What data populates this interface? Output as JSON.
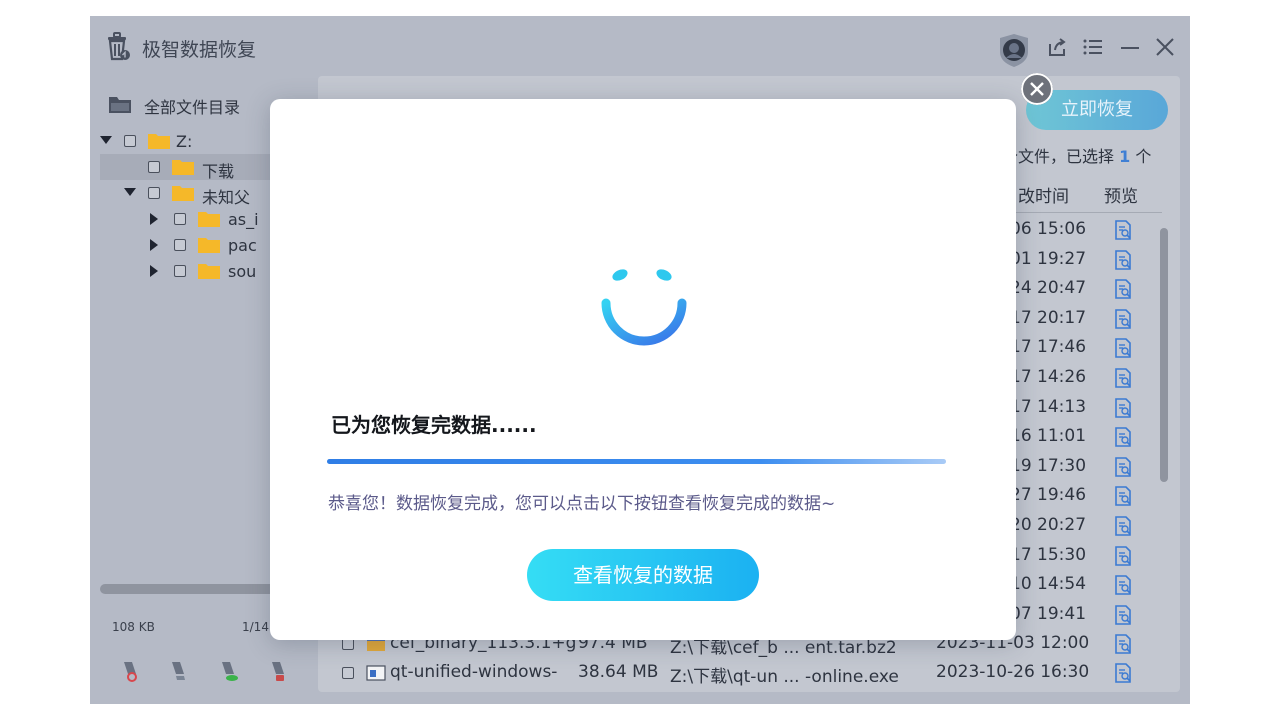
{
  "app": {
    "title": "极智数据恢复"
  },
  "left_panel": {
    "all_directories_label": "全部文件目录",
    "tree": [
      {
        "label": "Z:",
        "arrow": "down",
        "selected": false
      },
      {
        "label": "下载",
        "arrow": "none",
        "selected": true
      },
      {
        "label": "未知父",
        "arrow": "down",
        "selected": false
      },
      {
        "label": "as_i",
        "arrow": "right",
        "selected": false
      },
      {
        "label": "pac",
        "arrow": "right",
        "selected": false
      },
      {
        "label": "sou",
        "arrow": "right",
        "selected": false
      }
    ],
    "size_label": "108 KB",
    "page_label": "1/14"
  },
  "right_panel": {
    "recover_now_label": "立即恢复",
    "selection_prefix": "个文件，已选择",
    "selection_count": "1",
    "selection_suffix": "个",
    "col_time_fragment": "改时间",
    "col_preview": "预览",
    "row_times": [
      "06 15:06",
      "01 19:27",
      "24 20:47",
      "17 20:17",
      "17 17:46",
      "17 14:26",
      "17 14:13",
      "16 11:01",
      "19 17:30",
      "27 19:46",
      "20 20:27",
      "17 15:30",
      "10 14:54",
      "07 19:41"
    ],
    "bottom_rows": [
      {
        "name": "cef_binary_113.3.1+g",
        "size": "97.4 MB",
        "path": "Z:\\下载\\cef_b ... ent.tar.bz2",
        "time": "2023-11-03 12:00"
      },
      {
        "name": "qt-unified-windows-",
        "size": "38.64 MB",
        "path": "Z:\\下载\\qt-un ... -online.exe",
        "time": "2023-10-26 16:30"
      }
    ]
  },
  "modal": {
    "heading": "已为您恢复完数据......",
    "progress_percent": 100,
    "message": "恭喜您！数据恢复完成，您可以点击以下按钮查看恢复完成的数据~",
    "view_button_label": "查看恢复的数据"
  },
  "colors": {
    "accent": "#1bb1f2",
    "progress": "#2f7ee6",
    "folder": "#f5b829",
    "link_blue": "#3f7fd4"
  }
}
